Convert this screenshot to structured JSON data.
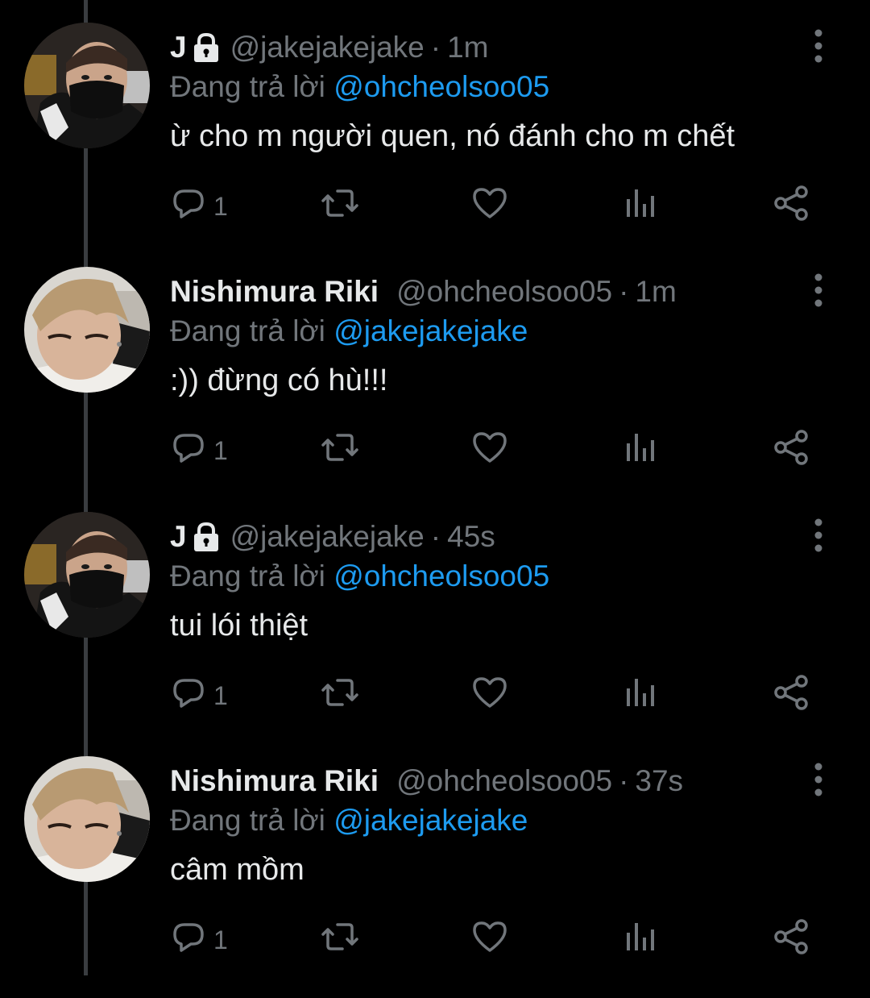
{
  "tweets": [
    {
      "name": "J",
      "locked": true,
      "handle": "@jakejakejake",
      "sep": "·",
      "time": "1m",
      "reply_prefix": "Đang trả lời",
      "reply_mention": "@ohcheolsoo05",
      "text": "ừ cho m người quen, nó đánh cho m chết",
      "reply_count": "1",
      "avatar": "masked-person"
    },
    {
      "name": "Nishimura Riki",
      "locked": false,
      "handle": "@ohcheolsoo05",
      "sep": "·",
      "time": "1m",
      "reply_prefix": "Đang trả lời",
      "reply_mention": "@jakejakejake",
      "text": ":)) đừng có hù!!!",
      "reply_count": "1",
      "avatar": "blond-person"
    },
    {
      "name": "J",
      "locked": true,
      "handle": "@jakejakejake",
      "sep": "·",
      "time": "45s",
      "reply_prefix": "Đang trả lời",
      "reply_mention": "@ohcheolsoo05",
      "text": "tui lói thiệt",
      "reply_count": "1",
      "avatar": "masked-person"
    },
    {
      "name": "Nishimura Riki",
      "locked": false,
      "handle": "@ohcheolsoo05",
      "sep": "·",
      "time": "37s",
      "reply_prefix": "Đang trả lời",
      "reply_mention": "@jakejakejake",
      "text": "câm mồm",
      "reply_count": "1",
      "avatar": "blond-person"
    }
  ],
  "colors": {
    "background": "#000000",
    "text": "#e7e9ea",
    "muted": "#71767b",
    "mention": "#1d9bf0",
    "thread_line": "#3a3d40"
  },
  "icons": [
    "reply-icon",
    "retweet-icon",
    "like-icon",
    "analytics-icon",
    "share-icon",
    "more-icon",
    "lock-icon"
  ]
}
